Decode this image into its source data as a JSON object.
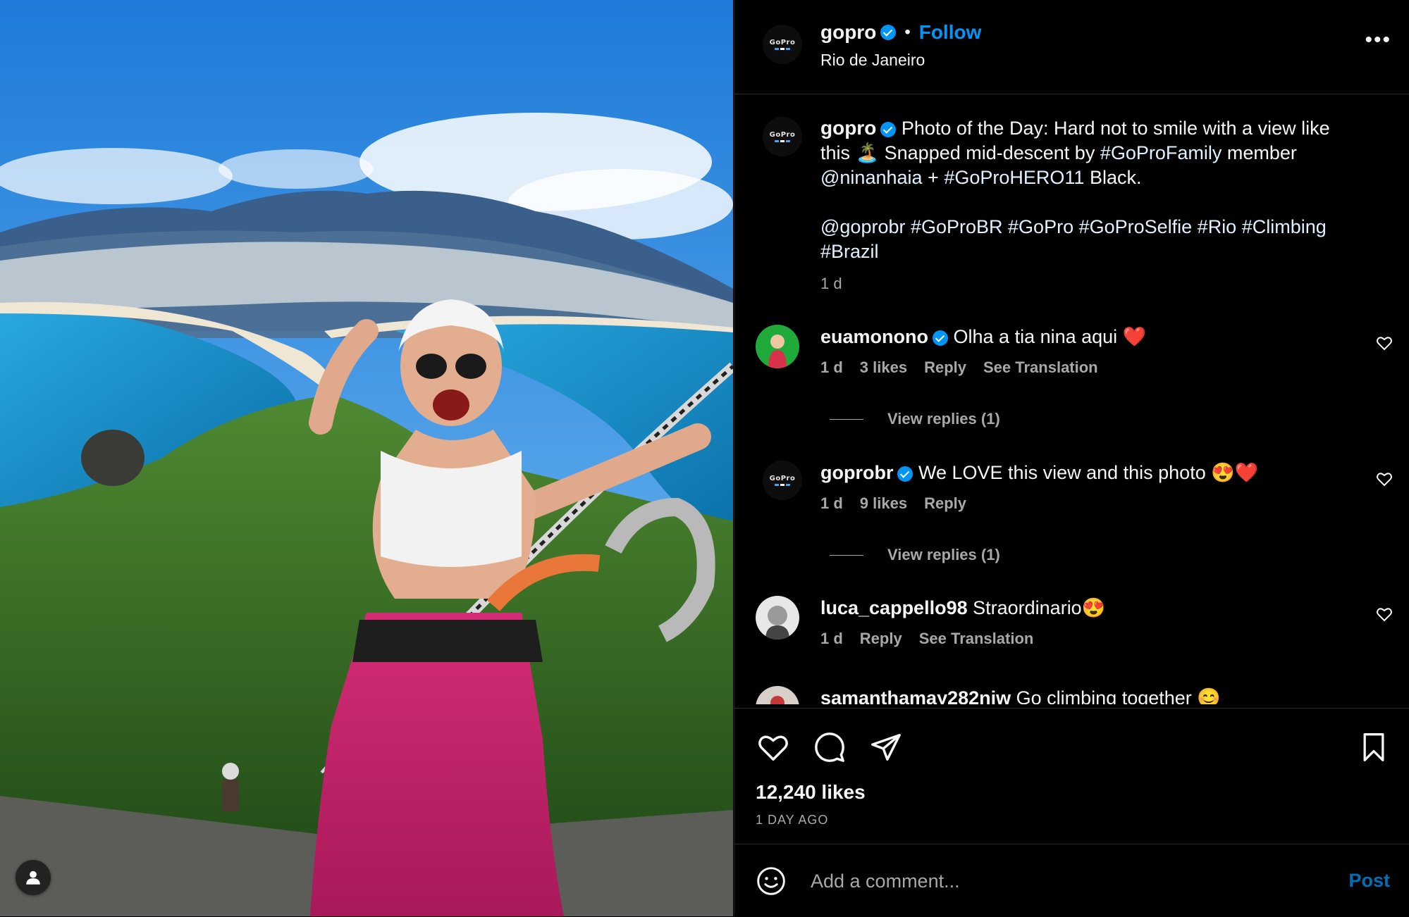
{
  "post": {
    "author": "gopro",
    "follow_label": "Follow",
    "dot": "•",
    "location": "Rio de Janeiro",
    "more_label": "•••",
    "caption_line1": "Photo of the Day: Hard not to smile with a view like this 🏝️ Snapped mid-descent by",
    "caption_tag1": "#GoProFamily",
    "caption_line1b": "member",
    "caption_mention": "@ninanhaia",
    "caption_plus": "+",
    "caption_tag2": "#GoProHERO11",
    "caption_end": "Black.",
    "caption_line2": "@goprobr #GoProBR #GoPro #GoProSelfie #Rio #Climbing #Brazil",
    "caption_time": "1 d"
  },
  "comments": [
    {
      "user": "euamonono",
      "text": "Olha a tia nina aqui ❤️",
      "time": "1 d",
      "likes": "3 likes",
      "reply": "Reply",
      "translate": "See Translation",
      "view_replies": "View replies (1)"
    },
    {
      "user": "goprobr",
      "text": "We LOVE this view and this photo 😍❤️",
      "time": "1 d",
      "likes": "9 likes",
      "reply": "Reply",
      "view_replies": "View replies (1)"
    },
    {
      "user": "luca_cappello98",
      "text": "Straordinario😍",
      "time": "1 d",
      "reply": "Reply",
      "translate": "See Translation"
    },
    {
      "user": "samanthamay282niw",
      "text": "Go climbing together 😊"
    }
  ],
  "actions": {
    "likes": "12,240 likes",
    "ago": "1 DAY AGO"
  },
  "comment_input": {
    "placeholder": "Add a comment...",
    "post_label": "Post"
  },
  "avatar_logo": "GoPro",
  "colors": {
    "background": "#000000",
    "link_blue": "#0095f6",
    "secondary_text": "#a8a8a8",
    "divider": "#262626"
  },
  "icons": [
    "heart-icon",
    "comment-icon",
    "share-icon",
    "bookmark-icon",
    "emoji-icon",
    "more-icon",
    "user-tag-icon",
    "verified-icon"
  ]
}
